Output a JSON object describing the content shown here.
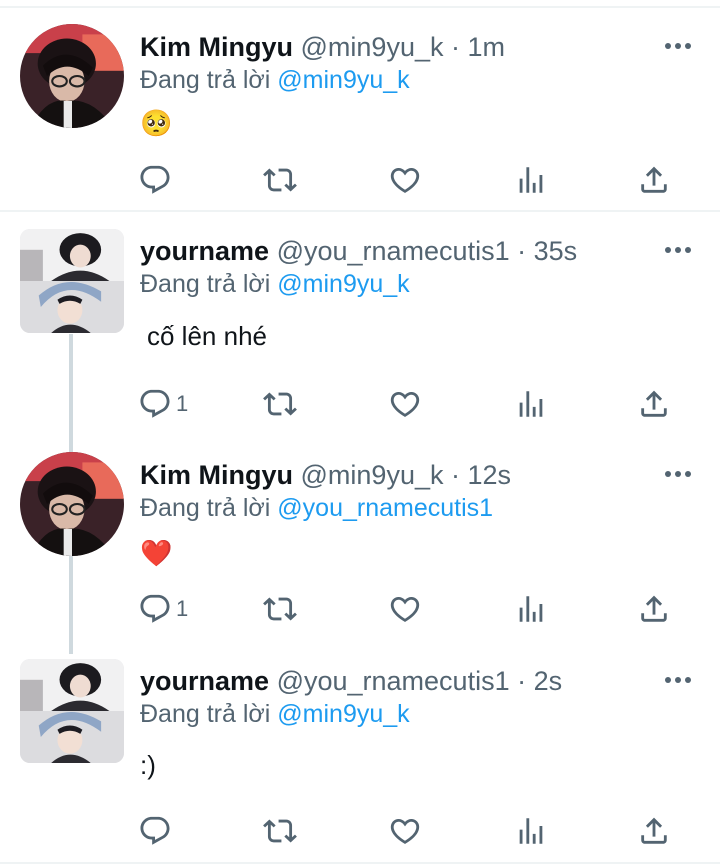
{
  "tweets": [
    {
      "name": "Kim Mingyu",
      "handle": "@min9yu_k",
      "time": "1m",
      "reply_prefix": "Đang trả lời",
      "reply_to": "@min9yu_k",
      "text": "🥺",
      "reply_count": ""
    },
    {
      "name": "yourname",
      "handle": "@you_rnamecutis1",
      "time": "35s",
      "reply_prefix": "Đang trả lời",
      "reply_to": "@min9yu_k",
      "text": "cố lên nhé",
      "reply_count": "1"
    },
    {
      "name": "Kim Mingyu",
      "handle": "@min9yu_k",
      "time": "12s",
      "reply_prefix": "Đang trả lời",
      "reply_to": "@you_rnamecutis1",
      "text": "❤️",
      "reply_count": "1"
    },
    {
      "name": "yourname",
      "handle": "@you_rnamecutis1",
      "time": "2s",
      "reply_prefix": "Đang trả lời",
      "reply_to": "@min9yu_k",
      "text": ":)",
      "reply_count": ""
    }
  ],
  "meta_separator": " · ",
  "icons": {
    "avatar_mingyu": "mingyu-avatar",
    "avatar_yourname": "yourname-avatar",
    "more": "more-dots-icon",
    "reply": "reply-icon",
    "retweet": "retweet-icon",
    "like": "heart-icon",
    "analytics": "analytics-icon",
    "share": "share-icon"
  },
  "colors": {
    "text": "#0f1419",
    "muted": "#536471",
    "link": "#1d9bf0",
    "divider": "#eff3f4",
    "thread_line": "#cfd9de"
  }
}
